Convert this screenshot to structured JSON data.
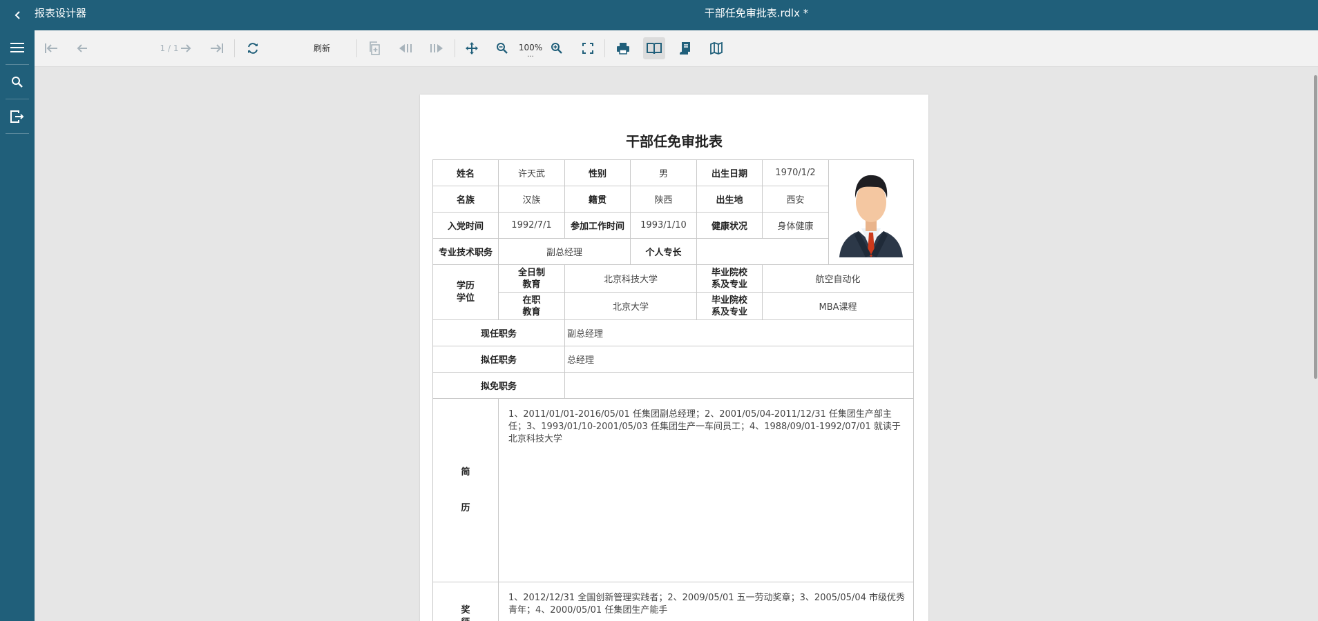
{
  "header": {
    "app_title": "报表设计器",
    "doc_title": "干部任免审批表.rdlx *"
  },
  "toolbar": {
    "page_indicator": "1 / 1",
    "refresh_label": "刷新",
    "zoom_label": "100%",
    "zoom_more": "..."
  },
  "report": {
    "title": "干部任免审批表",
    "labels": {
      "name": "姓名",
      "gender": "性别",
      "birth_date": "出生日期",
      "ethnicity": "名族",
      "native_place": "籍贯",
      "birthplace": "出生地",
      "party_date": "入党时间",
      "work_start": "参加工作时间",
      "health": "健康状况",
      "tech_title": "专业技术职务",
      "specialty": "个人专长",
      "education": "学历\n学位",
      "fulltime_edu": "全日制\n教育",
      "inservice_edu": "在职\n教育",
      "school_major": "毕业院校\n系及专业",
      "current_post": "现任职务",
      "proposed_post": "拟任职务",
      "proposed_removal": "拟免职务",
      "resume": "简\n\n历",
      "awards": "奖\n惩"
    },
    "values": {
      "name": "许天武",
      "gender": "男",
      "birth_date": "1970/1/2",
      "ethnicity": "汉族",
      "native_place": "陕西",
      "birthplace": "西安",
      "party_date": "1992/7/1",
      "work_start": "1993/1/10",
      "health": "身体健康",
      "tech_title": "副总经理",
      "specialty": "",
      "fulltime_school": "北京科技大学",
      "fulltime_major": "航空自动化",
      "inservice_school": "北京大学",
      "inservice_major": "MBA课程",
      "current_post": "副总经理",
      "proposed_post": "总经理",
      "proposed_removal": "",
      "resume": "1、2011/01/01-2016/05/01 任集团副总经理；2、2001/05/04-2011/12/31 任集团生产部主任；3、1993/01/10-2001/05/03 任集团生产一车间员工；4、1988/09/01-1992/07/01 就读于北京科技大学",
      "awards": "1、2012/12/31 全国创新管理实践者；2、2009/05/01 五一劳动奖章；3、2005/05/04 市级优秀青年；4、2000/05/01 任集团生产能手"
    }
  },
  "icons": [
    "chevron-left-icon",
    "menu-icon",
    "search-icon",
    "export-icon",
    "first-page-icon",
    "prev-page-icon",
    "next-page-icon",
    "last-page-icon",
    "refresh-icon",
    "page-copy-icon",
    "back-icon",
    "forward-icon",
    "pan-icon",
    "zoom-out-icon",
    "zoom-in-icon",
    "fullscreen-icon",
    "print-icon",
    "book-view-icon",
    "continuous-view-icon",
    "galley-view-icon"
  ],
  "colors": {
    "header_bg": "#205f7a",
    "toolbar_bg": "#f2f2f2",
    "icon_active": "#205f7a",
    "icon_disabled": "#a7b3bb"
  }
}
